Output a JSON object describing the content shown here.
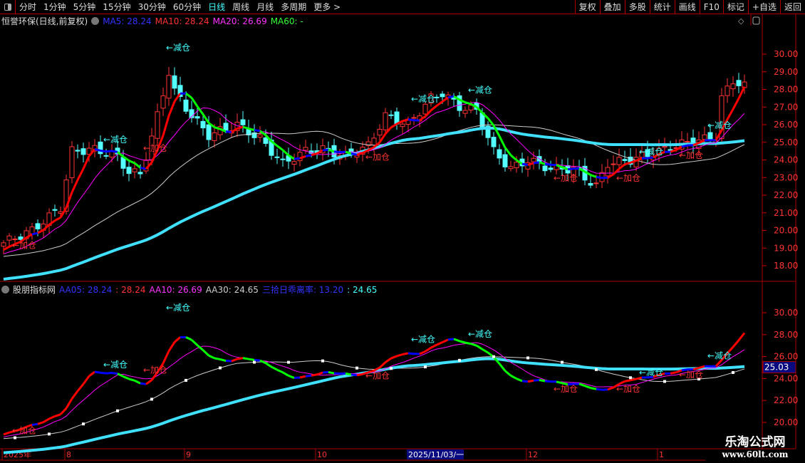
{
  "toolbar": {
    "periods": [
      "分时",
      "1分钟",
      "5分钟",
      "15分钟",
      "30分钟",
      "60分钟",
      "日线",
      "周线",
      "月线",
      "多周期",
      "更多 >"
    ],
    "active": "日线",
    "buttons": [
      "复权",
      "叠加",
      "多股",
      "统计",
      "画线",
      "F10",
      "标记",
      "+自选",
      "返回"
    ]
  },
  "main_legend": {
    "title": "恒誉环保(日线,前复权)",
    "ma5": "MA5: 28.24",
    "ma10": "MA10: 28.24",
    "ma20": "MA20: 26.69",
    "ma60": "MA60: -"
  },
  "sub_legend": {
    "title": "股朋指标网",
    "aa05": "AA05: 28.24",
    "aa05b": ": 28.24",
    "aa10": "AA10: 26.69",
    "aa30": "AA30: 24.65",
    "bias": "三拾日乖离率: 13.20",
    "biasb": ": 24.65"
  },
  "main_axis": {
    "ticks": [
      18,
      19,
      20,
      21,
      22,
      23,
      24,
      25,
      26,
      27,
      28,
      29,
      30
    ]
  },
  "sub_axis": {
    "ticks": [
      20,
      22,
      24,
      26,
      28,
      30
    ],
    "current": "25.03"
  },
  "x_axis": {
    "labels": [
      {
        "bar": 0,
        "text": "2025年"
      },
      {
        "bar": 11,
        "text": "8"
      },
      {
        "bar": 32,
        "text": "9"
      },
      {
        "bar": 55,
        "text": "10"
      },
      {
        "bar": 92,
        "text": "12"
      },
      {
        "bar": 115,
        "text": "1"
      }
    ],
    "cursor": {
      "bar": 71,
      "text": "2025/11/03/一"
    }
  },
  "colors": {
    "up": "#ff3232",
    "down": "#54ffff",
    "ma5": "#0000ff",
    "ma10": "#ff00ff",
    "ma30": "#cccccc",
    "ma60": "#40e0ff",
    "rise": "#ff0000",
    "fall": "#00ff00"
  },
  "price_path": [
    [
      0,
      19.3
    ],
    [
      5,
      20.0
    ],
    [
      10,
      21.3
    ],
    [
      12,
      24.5
    ],
    [
      16,
      24.6
    ],
    [
      20,
      24.2
    ],
    [
      22,
      23.3
    ],
    [
      24,
      23.2
    ],
    [
      26,
      25.3
    ],
    [
      27,
      26.5
    ],
    [
      29,
      29.0
    ],
    [
      30,
      27.9
    ],
    [
      33,
      26.5
    ],
    [
      36,
      25.4
    ],
    [
      41,
      26.0
    ],
    [
      45,
      25.2
    ],
    [
      49,
      23.8
    ],
    [
      53,
      24.5
    ],
    [
      56,
      24.6
    ],
    [
      60,
      24.2
    ],
    [
      64,
      24.8
    ],
    [
      67,
      26.5
    ],
    [
      71,
      26.0
    ],
    [
      75,
      27.5
    ],
    [
      77,
      27.8
    ],
    [
      80,
      27.0
    ],
    [
      83,
      26.8
    ],
    [
      86,
      24.5
    ],
    [
      89,
      23.5
    ],
    [
      92,
      24.0
    ],
    [
      96,
      23.5
    ],
    [
      100,
      23.5
    ],
    [
      104,
      22.5
    ],
    [
      106,
      23.8
    ],
    [
      110,
      24.0
    ],
    [
      115,
      24.5
    ],
    [
      120,
      25.0
    ],
    [
      125,
      25.3
    ],
    [
      126,
      27.5
    ],
    [
      128,
      28.5
    ],
    [
      130,
      28.2
    ]
  ],
  "signals": {
    "jian": "←减仓",
    "jia": "←加仓",
    "main": [
      [
        18,
        25.0,
        "jian"
      ],
      [
        29,
        30.2,
        "jian"
      ],
      [
        72,
        27.3,
        "jian"
      ],
      [
        82,
        27.8,
        "jian"
      ],
      [
        112,
        24.3,
        "jian"
      ],
      [
        124,
        25.8,
        "jian"
      ],
      [
        25,
        24.5,
        "jia"
      ],
      [
        2,
        19.0,
        "jia"
      ],
      [
        64,
        24.0,
        "jia"
      ],
      [
        97,
        22.8,
        "jia"
      ],
      [
        108,
        22.8,
        "jia"
      ],
      [
        119,
        24.1,
        "jia"
      ]
    ]
  },
  "watermark": {
    "line1": "乐淘公式网",
    "line2": "www.60lt.com"
  }
}
